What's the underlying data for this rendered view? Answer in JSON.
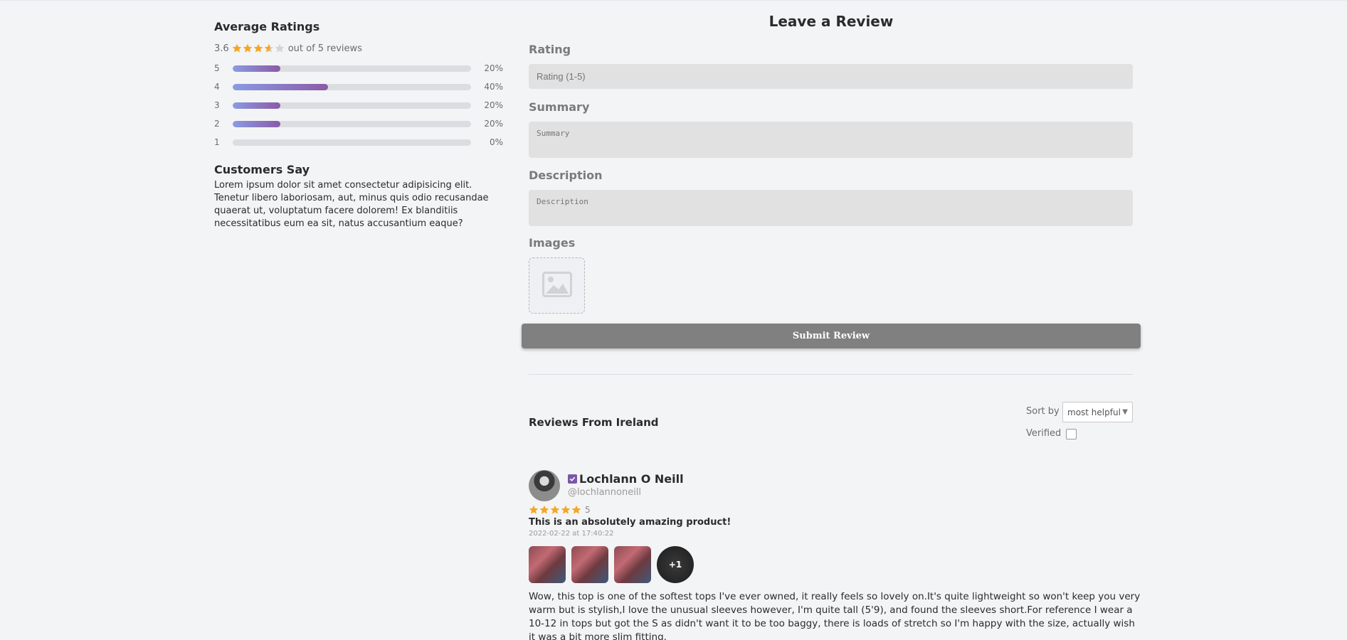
{
  "summary": {
    "title": "Average Ratings",
    "average": "3.6",
    "average_value": 3.6,
    "count_text": "out of 5 reviews",
    "distribution": [
      {
        "label": "5",
        "fraction": 0.2,
        "pct": "20%"
      },
      {
        "label": "4",
        "fraction": 0.4,
        "pct": "40%"
      },
      {
        "label": "3",
        "fraction": 0.2,
        "pct": "20%"
      },
      {
        "label": "2",
        "fraction": 0.2,
        "pct": "20%"
      },
      {
        "label": "1",
        "fraction": 0.0,
        "pct": "0%"
      }
    ],
    "customers_title": "Customers Say",
    "customers_text": "Lorem ipsum dolor sit amet consectetur adipisicing elit. Tenetur libero laboriosam, aut, minus quis odio recusandae quaerat ut, voluptatum facere dolorem! Ex blanditiis necessitatibus eum ea sit, natus accusantium eaque?"
  },
  "form": {
    "title": "Leave a Review",
    "rating_label": "Rating",
    "rating_placeholder": "Rating (1-5)",
    "summary_label": "Summary",
    "summary_placeholder": "Summary",
    "description_label": "Description",
    "description_placeholder": "Description",
    "images_label": "Images",
    "submit_label": "Submit Review"
  },
  "reviews": {
    "heading": "Reviews From Ireland",
    "sort_label": "Sort by",
    "sort_value": "most helpful",
    "verified_label": "Verified",
    "items": [
      {
        "name": "Lochlann O Neill",
        "handle": "@lochlannoneill",
        "rating": 5,
        "rating_text": "5",
        "title": "This is an absolutely amazing product!",
        "date": "2022-02-22 at 17:40:22",
        "extra_images": "+1",
        "body": "Wow, this top is one of the softest tops I've ever owned, it really feels so lovely on.It's quite lightweight so won't keep you very warm but is stylish,I love the unusual sleeves however, I'm quite tall (5'9), and found the sleeves short.For reference I wear a 10-12 in tops but got the S as didn't want it to be too baggy, there is loads of stretch so I'm happy with the size, actually wish it was a bit more slim fitting."
      }
    ]
  },
  "colors": {
    "star": "#f5a623",
    "star_empty": "#d3d3d3",
    "bar_start": "#8a9be3",
    "bar_end": "#8b5aa6",
    "submit_bg": "#808080",
    "verified_badge": "#7a57a8"
  }
}
